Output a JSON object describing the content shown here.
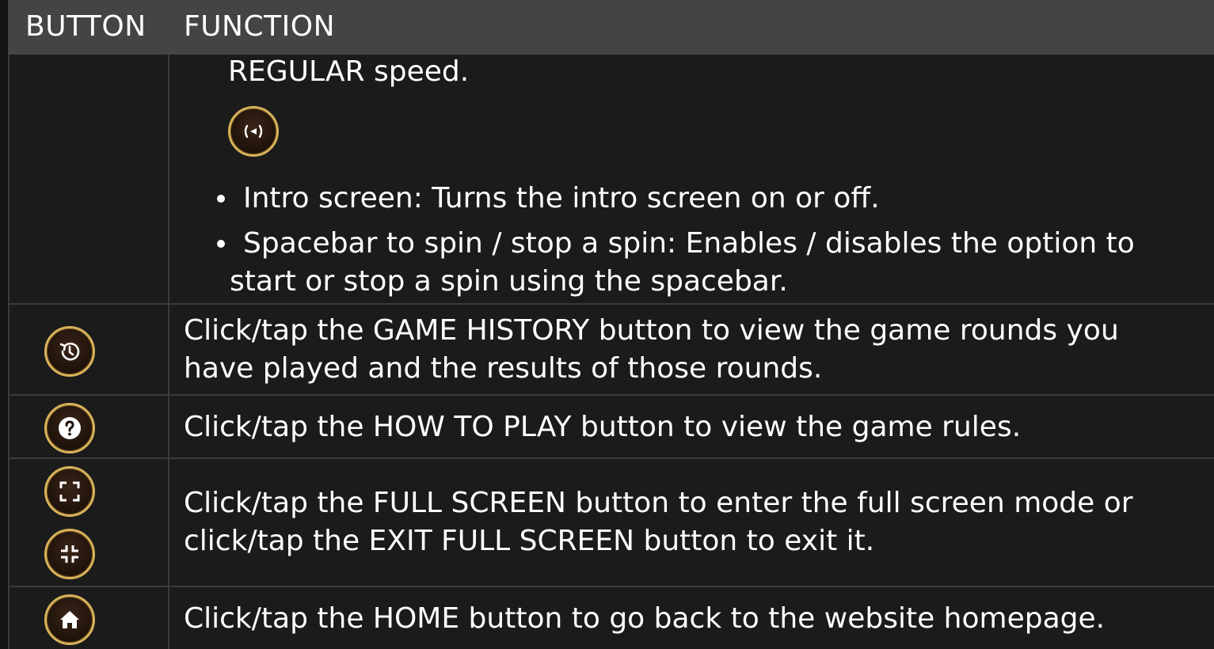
{
  "header": {
    "button_col": "BUTTON",
    "function_col": "FUNCTION"
  },
  "rows": {
    "settings_tail": {
      "regular_speed_text": "REGULAR speed.",
      "speed_icon": "regular-speed-icon",
      "bullets": [
        {
          "line1": "Intro screen: Turns the intro screen on or off."
        },
        {
          "line1": "Spacebar to spin / stop a spin: Enables / disables the option to",
          "line2": "start or stop a spin using the spacebar."
        }
      ]
    },
    "game_history": {
      "icon": "history-icon",
      "line1": "Click/tap the GAME HISTORY button to view the game rounds you",
      "line2": "have played and the results of those rounds."
    },
    "how_to_play": {
      "icon": "question-icon",
      "line1": "Click/tap the HOW TO PLAY button to view the game rules."
    },
    "full_screen": {
      "icon_enter": "fullscreen-enter-icon",
      "icon_exit": "fullscreen-exit-icon",
      "line1": "Click/tap the FULL SCREEN button to enter the full screen mode or",
      "line2": "click/tap the EXIT FULL SCREEN button to exit it."
    },
    "home": {
      "icon": "home-icon",
      "line1": "Click/tap the HOME button to go back to the website homepage."
    }
  },
  "colors": {
    "background": "#1b1b1b",
    "header_background": "#444444",
    "grid_line": "#3a3a3a",
    "icon_ring": "#d8b25a",
    "icon_fill": "#1e120a",
    "text": "#ffffff"
  }
}
